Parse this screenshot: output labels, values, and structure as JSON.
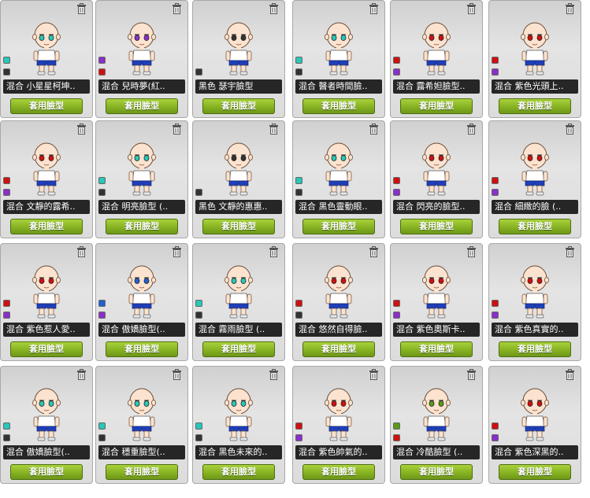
{
  "apply_label": "套用臉型",
  "cards": [
    {
      "name": "混合 小星星柯坤..",
      "colors": [
        "#27c8b8",
        "#333333"
      ]
    },
    {
      "name": "混合 兒時夢(紅..",
      "colors": [
        "#8a2fc8",
        "#d01010"
      ]
    },
    {
      "name": "黑色 瑟宇臉型",
      "colors": [
        "#333333"
      ]
    },
    {
      "name": "混合 醫者時間臉..",
      "colors": [
        "#27c8b8",
        "#333333"
      ]
    },
    {
      "name": "混合 露希妲臉型..",
      "colors": [
        "#d01010",
        "#8a2fc8"
      ]
    },
    {
      "name": "混合 紫色光頭上..",
      "colors": [
        "#d01010",
        "#8a2fc8"
      ]
    },
    {
      "name": "混合 文靜的露希..",
      "colors": [
        "#d01010",
        "#8a2fc8"
      ]
    },
    {
      "name": "混合 明亮臉型 (..",
      "colors": [
        "#27c8b8",
        "#333333"
      ]
    },
    {
      "name": "黑色 文靜的惠惠..",
      "colors": [
        "#333333"
      ]
    },
    {
      "name": "混合 黑色靈動眼..",
      "colors": [
        "#27c8b8",
        "#333333"
      ]
    },
    {
      "name": "混合 閃亮的臉型..",
      "colors": [
        "#d01010",
        "#8a2fc8"
      ]
    },
    {
      "name": "混合 細緻的臉 (..",
      "colors": [
        "#d01010",
        "#8a2fc8"
      ]
    },
    {
      "name": "混合 紫色惹人愛..",
      "colors": [
        "#d01010",
        "#8a2fc8"
      ]
    },
    {
      "name": "混合 傲嬌臉型(..",
      "colors": [
        "#2060d0",
        "#8a2fc8"
      ]
    },
    {
      "name": "混合 霧雨臉型 (..",
      "colors": [
        "#27c8b8",
        "#333333"
      ]
    },
    {
      "name": "混合 悠然自得臉..",
      "colors": [
        "#d01010",
        "#333333"
      ]
    },
    {
      "name": "混合 紫色奧斯卡..",
      "colors": [
        "#d01010",
        "#8a2fc8"
      ]
    },
    {
      "name": "混合 紫色真實的..",
      "colors": [
        "#d01010",
        "#8a2fc8"
      ]
    },
    {
      "name": "混合 傲嬌臉型(..",
      "colors": [
        "#27c8b8",
        "#333333"
      ]
    },
    {
      "name": "混合 穩重臉型(..",
      "colors": [
        "#27c8b8",
        "#333333"
      ]
    },
    {
      "name": "混合 黑色未來的..",
      "colors": [
        "#27c8b8",
        "#333333"
      ]
    },
    {
      "name": "混合 紫色帥氣的..",
      "colors": [
        "#d01010",
        "#8a2fc8"
      ]
    },
    {
      "name": "混合 冷酷臉型 (..",
      "colors": [
        "#5a9a18",
        "#d01010"
      ]
    },
    {
      "name": "混合 紫色深黑的..",
      "colors": [
        "#d01010",
        "#8a2fc8"
      ]
    }
  ]
}
